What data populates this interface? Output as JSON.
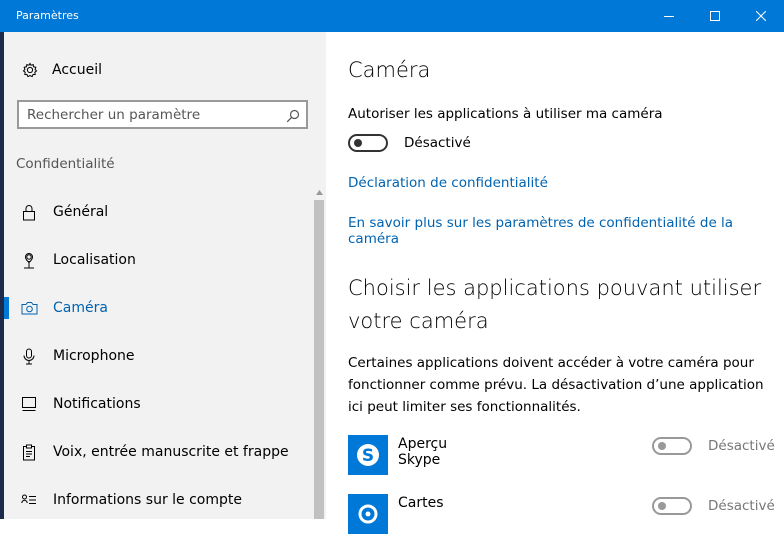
{
  "window": {
    "title": "Paramètres"
  },
  "sidebar": {
    "home_label": "Accueil",
    "search_placeholder": "Rechercher un paramètre",
    "section_label": "Confidentialité",
    "items": [
      {
        "label": "Général",
        "icon": "lock-icon",
        "active": false
      },
      {
        "label": "Localisation",
        "icon": "location-pin-icon",
        "active": false
      },
      {
        "label": "Caméra",
        "icon": "camera-icon",
        "active": true
      },
      {
        "label": "Microphone",
        "icon": "microphone-icon",
        "active": false
      },
      {
        "label": "Notifications",
        "icon": "notifications-icon",
        "active": false
      },
      {
        "label": "Voix, entrée manuscrite et frappe",
        "icon": "clipboard-icon",
        "active": false
      },
      {
        "label": "Informations sur le compte",
        "icon": "account-info-icon",
        "active": false
      }
    ]
  },
  "main": {
    "title": "Caméra",
    "allow_label": "Autoriser les applications à utiliser ma caméra",
    "allow_toggle_state": "Désactivé",
    "privacy_link": "Déclaration de confidentialité",
    "learn_more_link": "En savoir plus sur les paramètres de confidentialité de la caméra",
    "choose_heading": "Choisir les applications pouvant utiliser votre caméra",
    "choose_description": "Certaines applications doivent accéder à votre caméra pour fonctionner comme prévu. La désactivation d’une application ici peut limiter ses fonctionnalités.",
    "apps": [
      {
        "name": "Aperçu Skype",
        "state": "Désactivé",
        "icon": "skype-icon"
      },
      {
        "name": "Cartes",
        "state": "Désactivé",
        "icon": "maps-icon"
      }
    ]
  },
  "colors": {
    "accent": "#0078d7",
    "link": "#0063b1",
    "sidebar_bg": "#f2f2f2"
  }
}
